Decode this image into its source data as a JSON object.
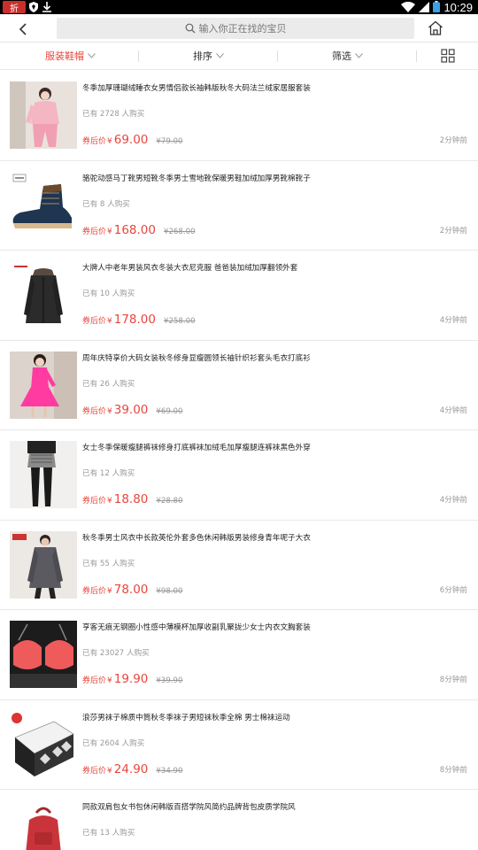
{
  "status_bar": {
    "badge": "折",
    "time": "10:29",
    "icons": [
      "shield-icon",
      "download-icon",
      "wifi-icon",
      "signal-icon",
      "battery-icon"
    ]
  },
  "header": {
    "search_placeholder": "输入你正在找的宝贝",
    "icons": [
      "back-arrow-icon",
      "search-icon",
      "home-icon"
    ]
  },
  "filters": {
    "category": "服装鞋帽",
    "sort": "排序",
    "filter": "筛选",
    "active_color": "#e8463c",
    "view_toggle_icon": "grid-view-icon"
  },
  "products": [
    {
      "title": "冬季加厚珊瑚绒睡衣女男情侣款长袖韩版秋冬大码法兰绒家居服套装",
      "sold": "已有 2728 人购买",
      "coupon_label": "券后价",
      "currency": "¥",
      "price": "69.00",
      "original_price": "¥79.00",
      "time": "2分钟前",
      "image": "pink-pajama-woman"
    },
    {
      "title": "骆驼动感马丁靴男短靴冬季男士雪地靴保暖男鞋加绒加厚男靴棉靴子",
      "sold": "已有 8 人购买",
      "coupon_label": "券后价",
      "currency": "¥",
      "price": "168.00",
      "original_price": "¥268.00",
      "time": "2分钟前",
      "image": "navy-boot"
    },
    {
      "title": "大牌人中老年男装风衣冬装大衣尼克服 爸爸装加绒加厚翻领外套",
      "sold": "已有 10 人购买",
      "coupon_label": "券后价",
      "currency": "¥",
      "price": "178.00",
      "original_price": "¥258.00",
      "time": "4分钟前",
      "image": "black-coat"
    },
    {
      "title": "周年庆特享价大码女装秋冬修身显瘦圆领长袖针织衫套头毛衣打底衫",
      "sold": "已有 26 人购买",
      "coupon_label": "券后价",
      "currency": "¥",
      "price": "39.00",
      "original_price": "¥69.00",
      "time": "4分钟前",
      "image": "pink-dress-woman"
    },
    {
      "title": "女士冬季保暖瘦腿裤袜修身打底裤袜加绒毛加厚瘦腿连裤袜黑色外穿",
      "sold": "已有 12 人购买",
      "coupon_label": "券后价",
      "currency": "¥",
      "price": "18.80",
      "original_price": "¥28.80",
      "time": "4分钟前",
      "image": "black-tights"
    },
    {
      "title": "秋冬季男士风衣中长款英伦外套多色休闲韩版男装修身青年呢子大衣",
      "sold": "已有 55 人购买",
      "coupon_label": "券后价",
      "currency": "¥",
      "price": "78.00",
      "original_price": "¥98.00",
      "time": "6分钟前",
      "image": "grey-overcoat"
    },
    {
      "title": "亨客无痕无钢圈小性感中薄模杯加厚收副乳聚拢少女士内衣文胸套装",
      "sold": "已有 23027 人购买",
      "coupon_label": "券后价",
      "currency": "¥",
      "price": "19.90",
      "original_price": "¥39.90",
      "time": "8分钟前",
      "image": "red-bra"
    },
    {
      "title": "浪莎男袜子棉质中筒秋冬季袜子男短袜秋季全棉 男士棉袜运动",
      "sold": "已有 2604 人购买",
      "coupon_label": "券后价",
      "currency": "¥",
      "price": "24.90",
      "original_price": "¥34.90",
      "time": "8分钟前",
      "image": "sock-box"
    },
    {
      "title": "同款双肩包女书包休闲韩版百搭学院风简约品牌背包皮质学院风",
      "sold": "已有 13 人购买",
      "image": "red-backpack"
    }
  ]
}
